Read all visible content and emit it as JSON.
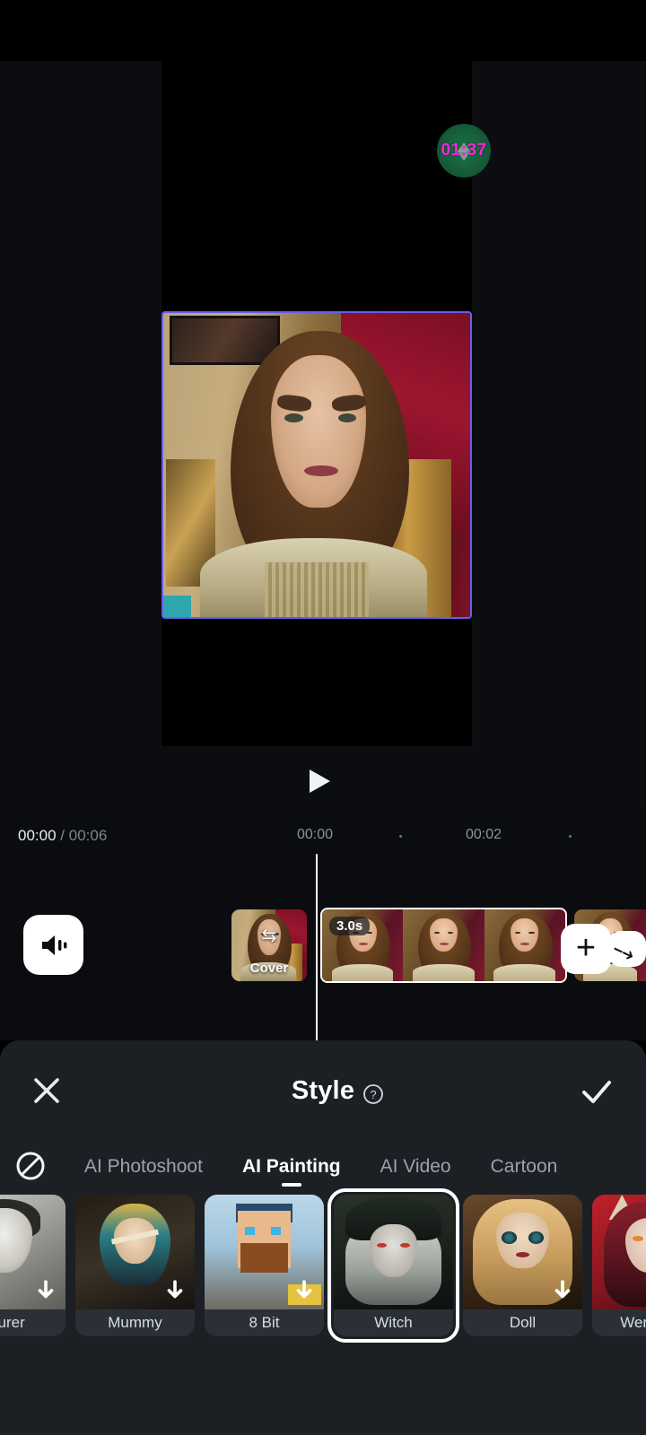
{
  "app": {
    "status_badge": {
      "time": "01:37",
      "glyph": "icon",
      "color": "#1b7a4b",
      "text_color": "#ff22e0"
    }
  },
  "preview": {
    "play_label": "play",
    "selection_border_color": "#6a5cf0"
  },
  "timeline": {
    "current_time": "00:00",
    "separator": "/",
    "total_time": "00:06",
    "ruler_labels": [
      "00:00",
      "00:02"
    ],
    "mute_icon": "volume-icon",
    "cover_label": "Cover",
    "cover_swap_icon": "swap-icon",
    "clip_duration": "3.0s",
    "add_label": "+"
  },
  "panel": {
    "title": "Style",
    "help_icon": "help-icon",
    "close_icon": "close-icon",
    "confirm_icon": "check-icon",
    "none_icon": "none-icon",
    "tabs": [
      {
        "label": "AI Photoshoot",
        "active": false
      },
      {
        "label": "AI Painting",
        "active": true
      },
      {
        "label": "AI Video",
        "active": false
      },
      {
        "label": "Cartoon",
        "active": false
      }
    ],
    "styles": [
      {
        "label": "Durer",
        "selected": false,
        "downloadable": true,
        "art": "art-durer"
      },
      {
        "label": "Mummy",
        "selected": false,
        "downloadable": true,
        "art": "art-mummy"
      },
      {
        "label": "8 Bit",
        "selected": false,
        "downloadable": true,
        "art": "art-8bit"
      },
      {
        "label": "Witch",
        "selected": true,
        "downloadable": false,
        "art": "art-witch"
      },
      {
        "label": "Doll",
        "selected": false,
        "downloadable": true,
        "art": "art-doll"
      },
      {
        "label": "Werewolf",
        "selected": false,
        "downloadable": false,
        "art": "art-wolf"
      }
    ]
  },
  "colors": {
    "panel_bg": "#1c1f23",
    "tile_bg": "#2b3037",
    "accent_selection": "#ffffff",
    "muted_text": "#9aa3ad"
  }
}
